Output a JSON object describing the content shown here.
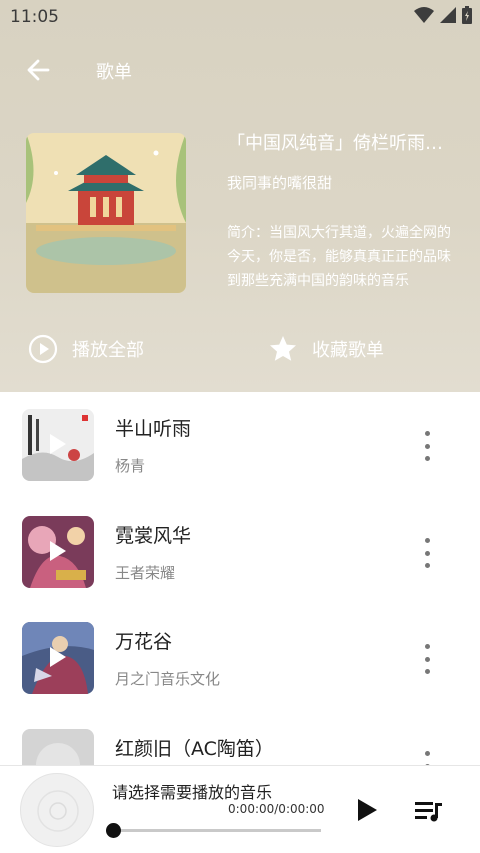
{
  "status": {
    "time": "11:05"
  },
  "topbar": {
    "title": "歌单"
  },
  "playlist": {
    "title": "「中国风纯音」倚栏听雨，素琴清音",
    "author": "我同事的嘴很甜",
    "description": "简介：当国风大行其道，火遍全网的今天，你是否，能够真真正正的品味到那些充满中国的韵味的音乐"
  },
  "actions": {
    "play_all": "播放全部",
    "collect": "收藏歌单"
  },
  "songs": [
    {
      "title": "半山听雨",
      "artist": "杨青"
    },
    {
      "title": "霓裳风华",
      "artist": "王者荣耀"
    },
    {
      "title": "万花谷",
      "artist": "月之门音乐文化"
    },
    {
      "title": "红颜旧（AC陶笛）",
      "artist": ""
    }
  ],
  "player": {
    "prompt": "请选择需要播放的音乐",
    "time": "0:00:00/0:00:00",
    "progress": 0
  }
}
